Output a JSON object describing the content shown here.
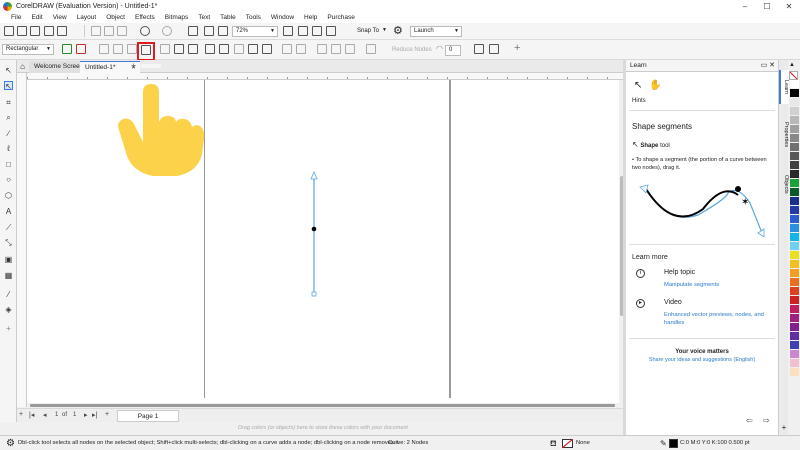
{
  "window": {
    "title": "CorelDRAW (Evaluation Version) - Untitled-1*",
    "minimize": "–",
    "maximize": "☐",
    "close": "✕"
  },
  "menu": [
    "File",
    "Edit",
    "View",
    "Layout",
    "Object",
    "Effects",
    "Bitmaps",
    "Text",
    "Table",
    "Tools",
    "Window",
    "Help",
    "Purchase"
  ],
  "toolbar1": {
    "zoom_value": "72%",
    "snap_to": "Snap To",
    "launch": "Launch"
  },
  "toolbar2": {
    "mode_value": "Rectangular",
    "reduce_nodes": "Reduce Nodes",
    "smoothness_value": "0"
  },
  "doc_tabs": {
    "welcome": "Welcome Screen",
    "active": "Untitled-1*",
    "add": "+"
  },
  "pagebar": {
    "page_of": "1",
    "of_label": "of",
    "page_total": "1",
    "page_tab": "Page 1"
  },
  "drag_hint": "Drag colors (or objects) here to store these colors with your document",
  "learn": {
    "header": "Learn",
    "hints": "Hints",
    "title": "Shape segments",
    "tool_bold": "Shape",
    "tool_rest": "tool",
    "bullet": "To shape a segment (the portion of a curve between two nodes), drag it.",
    "learn_more": "Learn more",
    "help_topic": "Help topic",
    "help_link": "Manipulate segments",
    "video": "Video",
    "video_link": "Enhanced vector previews, nodes, and handles",
    "voice_title": "Your voice matters",
    "voice_link": "Share your ideas and suggestions (English)"
  },
  "side_tabs": [
    "Learn",
    "Properties",
    "Objects"
  ],
  "status": {
    "hint": "Dbl-click tool selects all nodes on the selected object; Shift+click multi-selects; dbl-clicking on a curve adds a node; dbl-clicking on a node removes it",
    "object_info": "Curve: 2 Nodes",
    "fill": "None",
    "outline": "C:0 M:0 Y:0 K:100  0.500 pt"
  },
  "colors": {
    "accent": "#3b7dd8",
    "highlight": "#e01b24",
    "hand": "#fbd24a",
    "curve": "#5aa7e0",
    "link": "#2b79c9",
    "palette": [
      "#ffffff",
      "#000000",
      "#e8e8e8",
      "#d0d0d0",
      "#b8b8b8",
      "#a0a0a0",
      "#888888",
      "#707070",
      "#585858",
      "#404040",
      "#2a2a2a",
      "#1ea03a",
      "#0d5a2a",
      "#1b2f8a",
      "#233aa8",
      "#2b5fd0",
      "#2a8fe0",
      "#14b4e8",
      "#6fd0f0",
      "#e8e020",
      "#f0c020",
      "#f0a020",
      "#e87020",
      "#e04020",
      "#d02020",
      "#c02060",
      "#a02080",
      "#802090",
      "#6030a0",
      "#4040b0",
      "#cc88cc",
      "#f0c0d0",
      "#f8e0c0"
    ]
  }
}
